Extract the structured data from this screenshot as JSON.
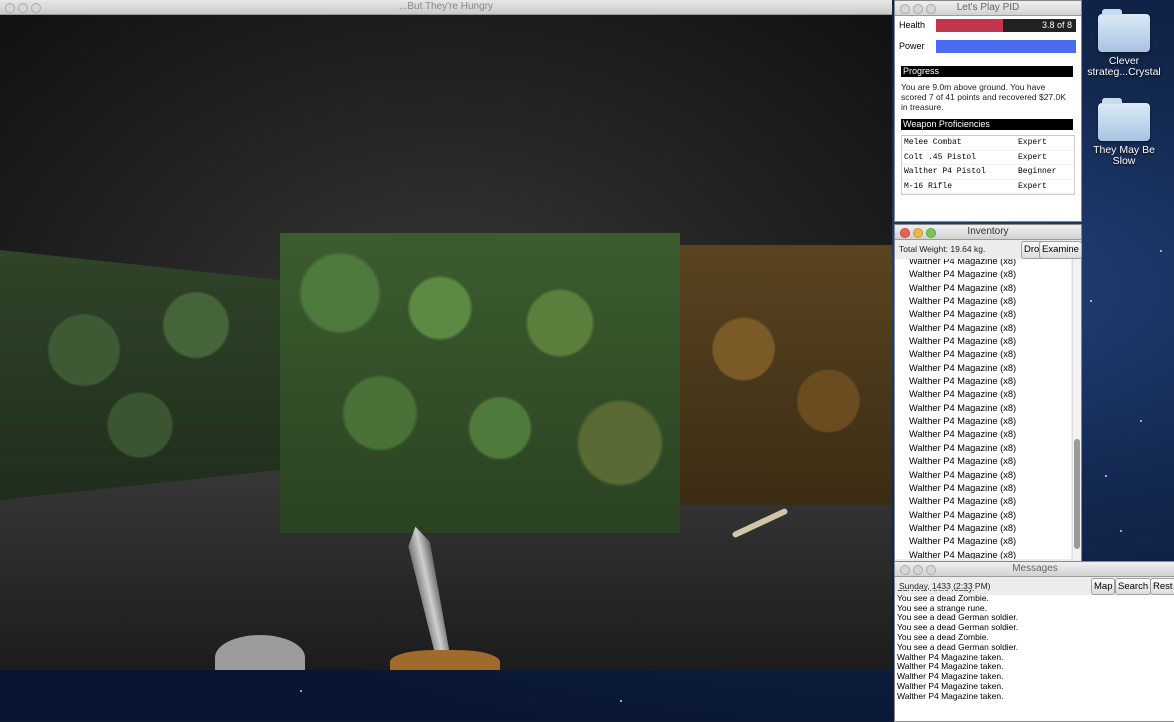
{
  "game_window": {
    "title": "...But They're Hungry"
  },
  "stats_panel": {
    "title": "Let's Play PID",
    "health": {
      "label": "Health",
      "value_text": "3.8 of 8",
      "fraction": 0.475,
      "color": "#c4344a"
    },
    "power": {
      "label": "Power",
      "fraction": 1.0,
      "color": "#4a6cf0"
    },
    "progress": {
      "heading": "Progress",
      "text": "You are 9.0m above ground.  You have scored 7 of 41 points and recovered $27.0K in treasure."
    },
    "weapons": {
      "heading": "Weapon Proficiencies",
      "rows": [
        {
          "name": "Melee Combat",
          "level": "Expert"
        },
        {
          "name": "Colt .45 Pistol",
          "level": "Expert"
        },
        {
          "name": "Walther P4 Pistol",
          "level": "Beginner"
        },
        {
          "name": "M-16 Rifle",
          "level": "Expert"
        }
      ]
    }
  },
  "inventory": {
    "title": "Inventory",
    "total_weight": "Total Weight: 19.64 kg.",
    "drop_label": "Drop",
    "examine_label": "Examine",
    "items": [
      "Walther P4 Magazine (x8)",
      "Walther P4 Magazine (x8)",
      "Walther P4 Magazine (x8)",
      "Walther P4 Magazine (x8)",
      "Walther P4 Magazine (x8)",
      "Walther P4 Magazine (x8)",
      "Walther P4 Magazine (x8)",
      "Walther P4 Magazine (x8)",
      "Walther P4 Magazine (x8)",
      "Walther P4 Magazine (x8)",
      "Walther P4 Magazine (x8)",
      "Walther P4 Magazine (x8)",
      "Walther P4 Magazine (x8)",
      "Walther P4 Magazine (x8)",
      "Walther P4 Magazine (x8)",
      "Walther P4 Magazine (x8)",
      "Walther P4 Magazine (x8)",
      "Walther P4 Magazine (x8)",
      "Walther P4 Magazine (x8)",
      "Walther P4 Magazine (x8)",
      "Walther P4 Magazine (x8)",
      "Walther P4 Magazine (x8)",
      "Walther P4 Magazine (x8)"
    ]
  },
  "messages": {
    "title": "Messages",
    "date": "Sunday, 1433 (2:33 PM)",
    "map_label": "Map",
    "search_label": "Search",
    "rest_label": "Rest",
    "log": [
      "Survival Knife ready.",
      "You see a dead Zombie.",
      "You see a strange rune.",
      "You see a dead German soldier.",
      "You see a dead German soldier.",
      "You see a dead Zombie.",
      "You see a dead German soldier.",
      "Walther P4 Magazine taken.",
      "Walther P4 Magazine taken.",
      "Walther P4 Magazine taken.",
      "Walther P4 Magazine taken.",
      "Walther P4 Magazine taken."
    ]
  },
  "desktop_icons": [
    {
      "label": "Clever strateg...Crystal",
      "icon": "folder-icon"
    },
    {
      "label": "They May Be Slow",
      "icon": "folder-icon"
    }
  ]
}
